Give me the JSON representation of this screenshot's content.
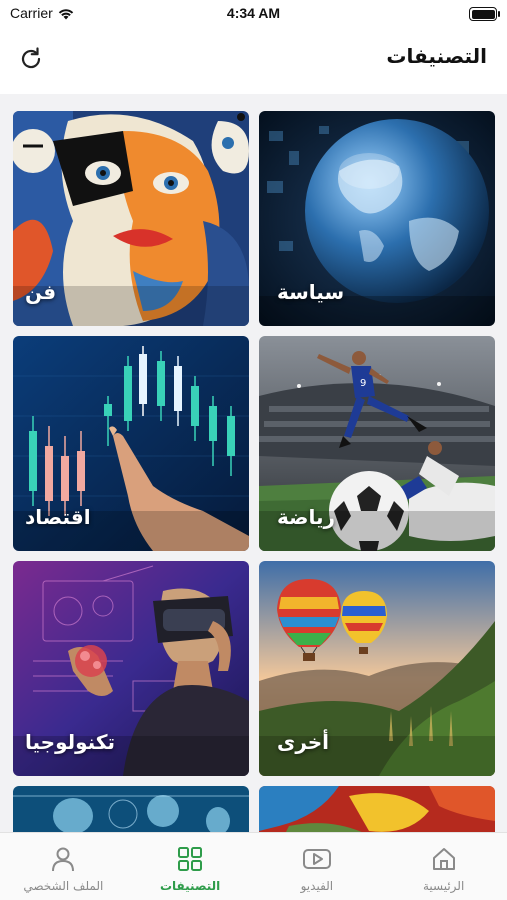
{
  "status_bar": {
    "carrier": "Carrier",
    "time": "4:34 AM",
    "battery_level": 1.0
  },
  "header": {
    "title": "التصنيفات",
    "refresh_icon": "refresh-icon"
  },
  "categories": [
    {
      "label": "سياسة",
      "image": "globe"
    },
    {
      "label": "فن",
      "image": "abstract-art"
    },
    {
      "label": "رياضة",
      "image": "football"
    },
    {
      "label": "اقتصاد",
      "image": "stock-chart"
    },
    {
      "label": "أخرى",
      "image": "hot-air-balloons"
    },
    {
      "label": "تكنولوجيا",
      "image": "vr-headset"
    }
  ],
  "tabbar": {
    "active_color": "#2e9c4a",
    "inactive_color": "#8a8a8a",
    "tabs": [
      {
        "label": "الرئيسية",
        "icon": "home-icon"
      },
      {
        "label": "الفيديو",
        "icon": "video-icon"
      },
      {
        "label": "التصنيفات",
        "icon": "grid-icon",
        "active": true
      },
      {
        "label": "الملف الشخصي",
        "icon": "profile-icon"
      }
    ]
  }
}
